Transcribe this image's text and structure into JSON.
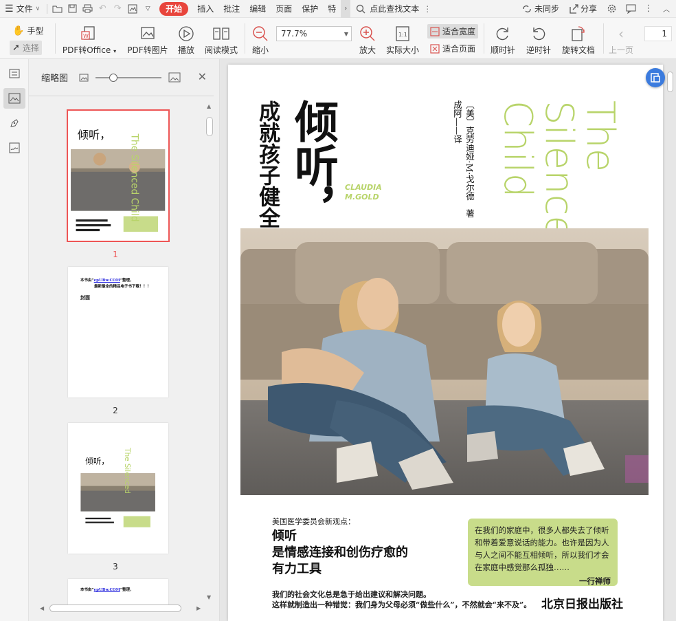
{
  "menubar": {
    "file_label": "文件",
    "tabs": [
      "开始",
      "插入",
      "批注",
      "编辑",
      "页面",
      "保护",
      "特"
    ],
    "search_label": "点此查找文本",
    "sync_label": "未同步",
    "share_label": "分享"
  },
  "toolbar": {
    "hand_label": "手型",
    "select_label": "选择",
    "pdf_to_office": "PDF转Office",
    "pdf_to_image": "PDF转图片",
    "play": "播放",
    "read_mode": "阅读模式",
    "zoom_out": "缩小",
    "zoom_value": "77.7%",
    "zoom_in": "放大",
    "actual_size": "实际大小",
    "fit_width": "适合宽度",
    "fit_page": "适合页面",
    "rotate_cw": "顺时针",
    "rotate_ccw": "逆时针",
    "rotate_doc": "旋转文档",
    "prev_page": "上一页",
    "page_number": "1"
  },
  "thumbpanel": {
    "title": "缩略图",
    "pages": [
      "1",
      "2",
      "3"
    ],
    "page2_line1": "本书由“",
    "page2_link1": "epUBw.COM",
    "page2_line1b": "”整理，",
    "page2_line2": "最新最全的精品电子书下载！！！",
    "page2_cover": "封面"
  },
  "cover": {
    "cn_title_big": "倾听，",
    "cn_title_small": "成就孩子健全人格",
    "author_en_1": "CLAUDIA",
    "author_en_2": "M.GOLD",
    "author_cn": "〔美〕克劳迪娅·M·戈尔德　著",
    "translator": "成阿——译",
    "en_title_1": "The",
    "en_title_2": "Silenced",
    "en_title_3": "Child",
    "subtitle_small": "美国医学委员会新观点：",
    "subtitle_1": "倾听",
    "subtitle_2": "是情感连接和创伤疗愈的",
    "subtitle_3": "有力工具",
    "quote": "在我们的家庭中，很多人都失去了倾听和带着爱意说话的能力。也许是因为人与人之间不能互相倾听，所以我们才会在家庭中感觉那么孤独……",
    "quote_author": "一行禅师",
    "bottom_1": "我们的社会文化总是急于给出建议和解决问题。",
    "bottom_2": "这样就制造出一种错觉：我们身为父母必须“做些什么”，不然就会“来不及”。",
    "publisher": "北京日报出版社"
  },
  "colors": {
    "accent": "#e8453c",
    "cover_green": "#b8d46a",
    "quote_box": "#c8dc8a",
    "float_button": "#3b7bde"
  }
}
